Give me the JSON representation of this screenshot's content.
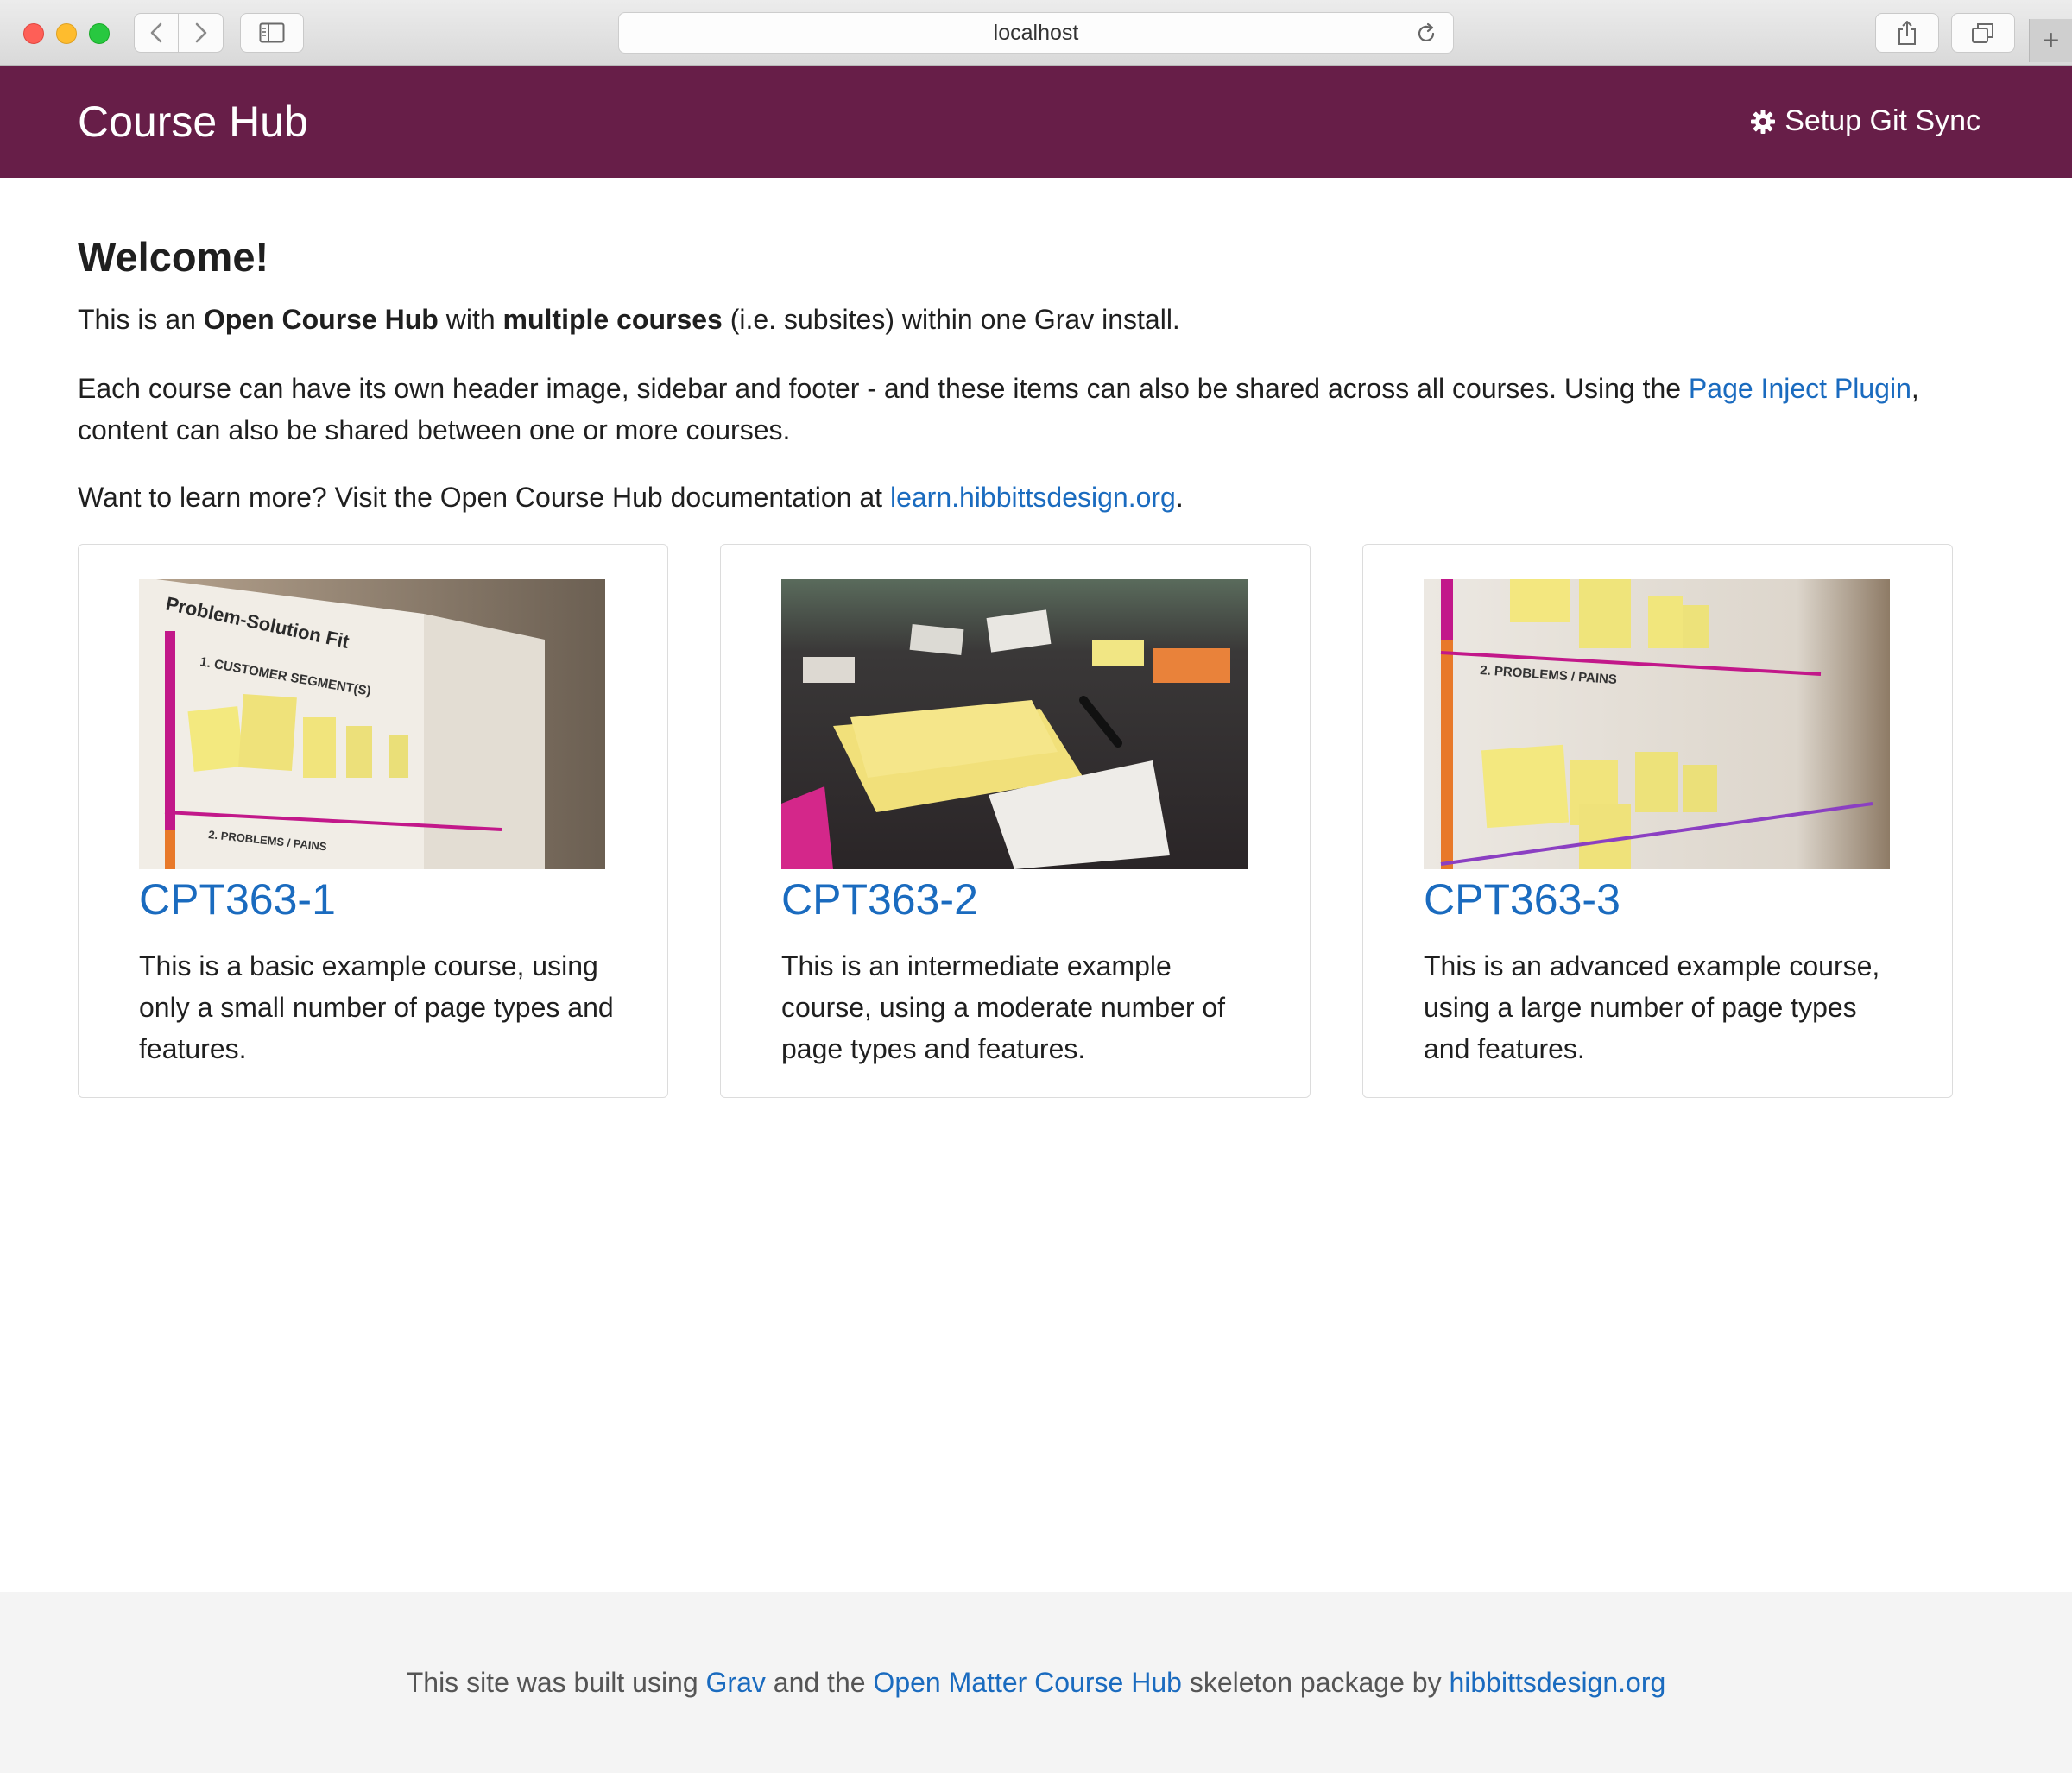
{
  "browser": {
    "url": "localhost",
    "plus_label": "+"
  },
  "header": {
    "title": "Course Hub",
    "git_sync_label": "Setup Git Sync",
    "bg_color": "#671e48"
  },
  "welcome": {
    "heading": "Welcome!",
    "p1": {
      "t1": "This is an ",
      "b1": "Open Course Hub",
      "t2": " with ",
      "b2": "multiple courses",
      "t3": " (i.e. subsites) within one Grav install."
    },
    "p2": {
      "t1": "Each course can have its own header image, sidebar and footer - and these items can also be shared across all courses. Using the ",
      "link": "Page Inject Plugin",
      "t2": ", content can also be shared between one or more courses."
    },
    "p3": {
      "t1": "Want to learn more? Visit the Open Course Hub documentation at ",
      "link": "learn.hibbittsdesign.org",
      "t2": "."
    }
  },
  "courses": [
    {
      "title": "CPT363-1",
      "description": "This is a basic example course, using only a small number of page types and features."
    },
    {
      "title": "CPT363-2",
      "description": "This is an intermediate example course, using a moderate number of page types and features."
    },
    {
      "title": "CPT363-3",
      "description": "This is an advanced example course, using a large number of page types and features."
    }
  ],
  "footer": {
    "t1": "This site was built using ",
    "link1": "Grav",
    "t2": " and the ",
    "link2": "Open Matter Course Hub",
    "t3": " skeleton package by ",
    "link3": "hibbittsdesign.org"
  },
  "colors": {
    "link": "#1a6bbf",
    "footer_bg": "#f4f4f4"
  }
}
